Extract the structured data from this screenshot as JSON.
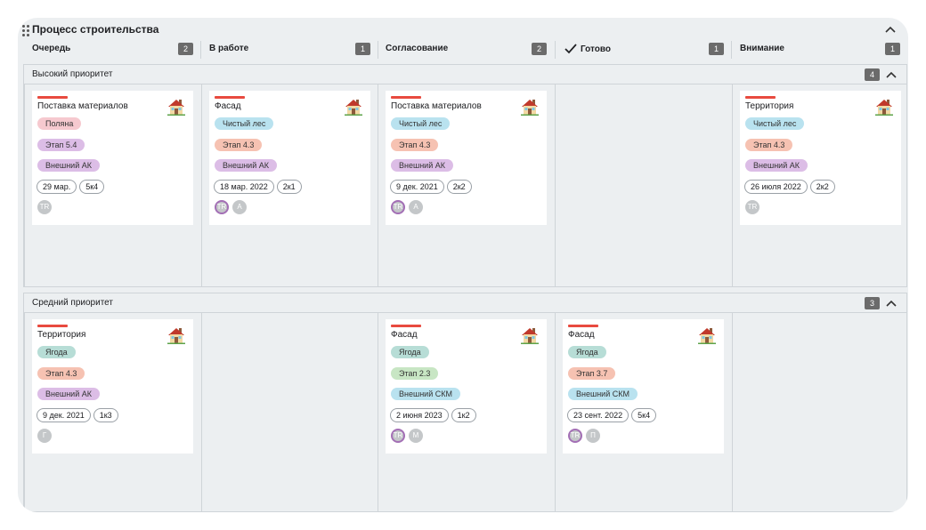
{
  "board": {
    "title": "Процесс строительства",
    "columns": [
      {
        "label": "Очередь",
        "count": "2",
        "icon": ""
      },
      {
        "label": "В работе",
        "count": "1",
        "icon": ""
      },
      {
        "label": "Согласование",
        "count": "2",
        "icon": ""
      },
      {
        "label": "Готово",
        "count": "1",
        "icon": "check-icon"
      },
      {
        "label": "Внимание",
        "count": "1",
        "icon": ""
      }
    ]
  },
  "colors": {
    "priority_bar": "#e84a3f",
    "tag_pink": "#f6c9cf",
    "tag_purple": "#dcbde6",
    "tag_blue": "#b9e2ef",
    "tag_peach": "#f6c2b2",
    "tag_teal": "#b7ddd6",
    "tag_green": "#c8e6c4"
  },
  "groups": [
    {
      "title": "Высокий приоритет",
      "count": "4",
      "cards": [
        {
          "title": "Поставка материалов",
          "tags": [
            "Поляна",
            "Этап 5.4",
            "Внешний АК"
          ],
          "chips": [
            "29 мар.",
            "5к4"
          ],
          "avatars": [
            "TR"
          ]
        },
        {
          "title": "Фасад",
          "tags": [
            "Чистый лес",
            "Этап 4.3",
            "Внешний АК"
          ],
          "chips": [
            "18 мар. 2022",
            "2к1"
          ],
          "avatars": [
            "TR",
            "A"
          ]
        },
        {
          "title": "Поставка материалов",
          "tags": [
            "Чистый лес",
            "Этап 4.3",
            "Внешний АК"
          ],
          "chips": [
            "9 дек. 2021",
            "2к2"
          ],
          "avatars": [
            "TR",
            "A"
          ]
        },
        {
          "title": "Территория",
          "tags": [
            "Чистый лес",
            "Этап 4.3",
            "Внешний АК"
          ],
          "chips": [
            "26 июля 2022",
            "2к2"
          ],
          "avatars": [
            "TR"
          ]
        }
      ]
    },
    {
      "title": "Средний приоритет",
      "count": "3",
      "cards": [
        {
          "title": "Территория",
          "tags": [
            "Ягода",
            "Этап 4.3",
            "Внешний АК"
          ],
          "chips": [
            "9 дек. 2021",
            "1к3"
          ],
          "avatars": [
            "Г"
          ]
        },
        {
          "title": "Фасад",
          "tags": [
            "Ягода",
            "Этап 2.3",
            "Внешний СКМ"
          ],
          "chips": [
            "2 июня 2023",
            "1к2"
          ],
          "avatars": [
            "TR",
            "М"
          ]
        },
        {
          "title": "Фасад",
          "tags": [
            "Ягода",
            "Этап 3.7",
            "Внешний СКМ"
          ],
          "chips": [
            "23 сент. 2022",
            "5к4"
          ],
          "avatars": [
            "TR",
            "П"
          ]
        }
      ]
    }
  ]
}
